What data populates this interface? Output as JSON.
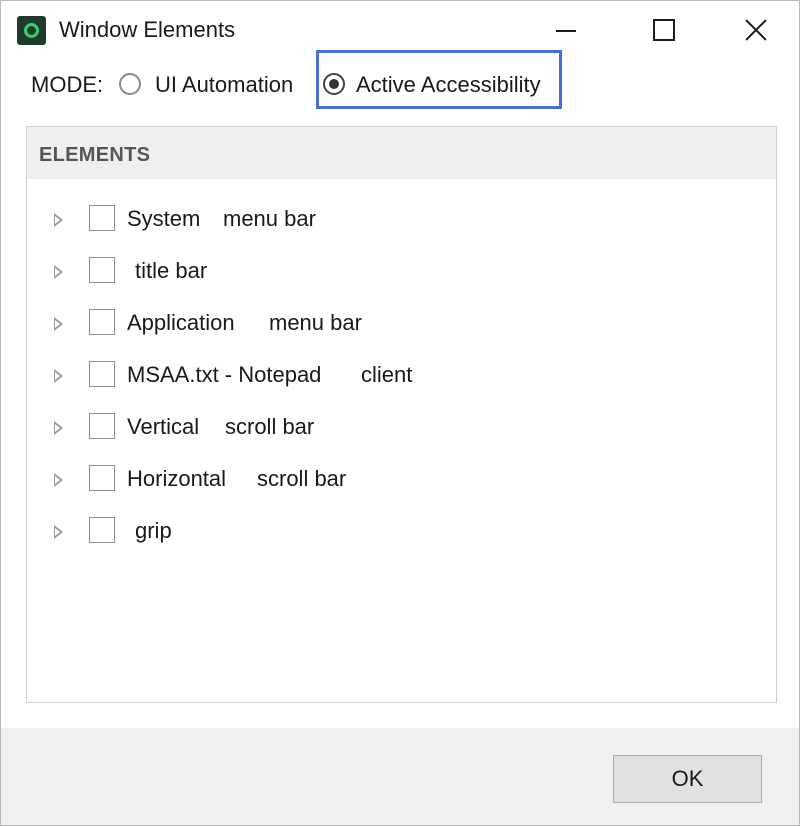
{
  "window": {
    "title": "Window Elements"
  },
  "mode": {
    "label": "MODE:",
    "options": [
      {
        "label": "UI Automation",
        "checked": false
      },
      {
        "label": "Active Accessibility",
        "checked": true
      }
    ]
  },
  "elements": {
    "header": "ELEMENTS",
    "rows": [
      {
        "name": "System",
        "role": "menu bar"
      },
      {
        "name": "",
        "role": "title bar"
      },
      {
        "name": "Application",
        "role": "menu bar"
      },
      {
        "name": "MSAA.txt - Notepad",
        "role": "client"
      },
      {
        "name": "Vertical",
        "role": "scroll bar"
      },
      {
        "name": "Horizontal",
        "role": "scroll bar"
      },
      {
        "name": "",
        "role": "grip"
      }
    ]
  },
  "footer": {
    "ok_label": "OK"
  },
  "colors": {
    "focus_outline": "#4a6ee0",
    "header_bg": "#efefef",
    "footer_bg": "#f0f0f0"
  },
  "icons": {
    "app": "app-logo-icon",
    "minimize": "minimize-icon",
    "maximize": "maximize-icon",
    "close": "close-icon",
    "expander": "expand-arrow-icon"
  }
}
